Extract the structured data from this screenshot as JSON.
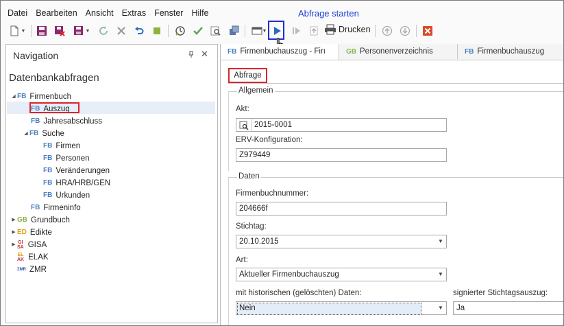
{
  "menu": [
    "Datei",
    "Bearbeiten",
    "Ansicht",
    "Extras",
    "Fenster",
    "Hilfe"
  ],
  "annotation": "Abfrage starten",
  "toolbar": {
    "print_label": "Drucken"
  },
  "navigation": {
    "title": "Navigation",
    "pin": "ᵖ",
    "close": "✕",
    "section": "Datenbankabfragen",
    "tree": [
      {
        "tag": "FB",
        "label": "Firmenbuch"
      },
      {
        "tag": "FB",
        "label": "Auszug"
      },
      {
        "tag": "FB",
        "label": "Jahresabschluss"
      },
      {
        "tag": "FB",
        "label": "Suche"
      },
      {
        "tag": "FB",
        "label": "Firmen"
      },
      {
        "tag": "FB",
        "label": "Personen"
      },
      {
        "tag": "FB",
        "label": "Veränderungen"
      },
      {
        "tag": "FB",
        "label": "HRA/HRB/GEN"
      },
      {
        "tag": "FB",
        "label": "Urkunden"
      },
      {
        "tag": "FB",
        "label": "Firmeninfo"
      },
      {
        "tag": "GB",
        "label": "Grundbuch"
      },
      {
        "tag": "ED",
        "label": "Edikte"
      },
      {
        "tag": "GISA",
        "label": "GISA"
      },
      {
        "tag": "ELAK",
        "label": "ELAK"
      },
      {
        "tag": "ZMR",
        "label": "ZMR"
      }
    ]
  },
  "tabs": [
    {
      "tag": "FB",
      "label": "Firmenbuchauszug - Firı"
    },
    {
      "tag": "GB",
      "label": "Personenverzeichnis"
    },
    {
      "tag": "FB",
      "label": "Firmenbuchauszug"
    }
  ],
  "subtab": "Abfrage",
  "form": {
    "allgemein_title": "Allgemein",
    "akt_label": "Akt:",
    "akt_value": "2015-0001",
    "erv_label": "ERV-Konfiguration:",
    "erv_value": "Z979449",
    "daten_title": "Daten",
    "fbnr_label": "Firmenbuchnummer:",
    "fbnr_value": "204666f",
    "stichtag_label": "Stichtag:",
    "stichtag_value": "20.10.2015",
    "art_label": "Art:",
    "art_value": "Aktueller Firmenbuchauszug",
    "hist_label": "mit historischen (gelöschten) Daten:",
    "hist_value": "Nein",
    "sign_label": "signierter Stichtagsauszug:",
    "sign_value": "Ja"
  },
  "colors": {
    "accent": "#1c2fd0",
    "highlight": "#d9262b",
    "fb": "#4a7fc1",
    "gb": "#8ab34a"
  }
}
